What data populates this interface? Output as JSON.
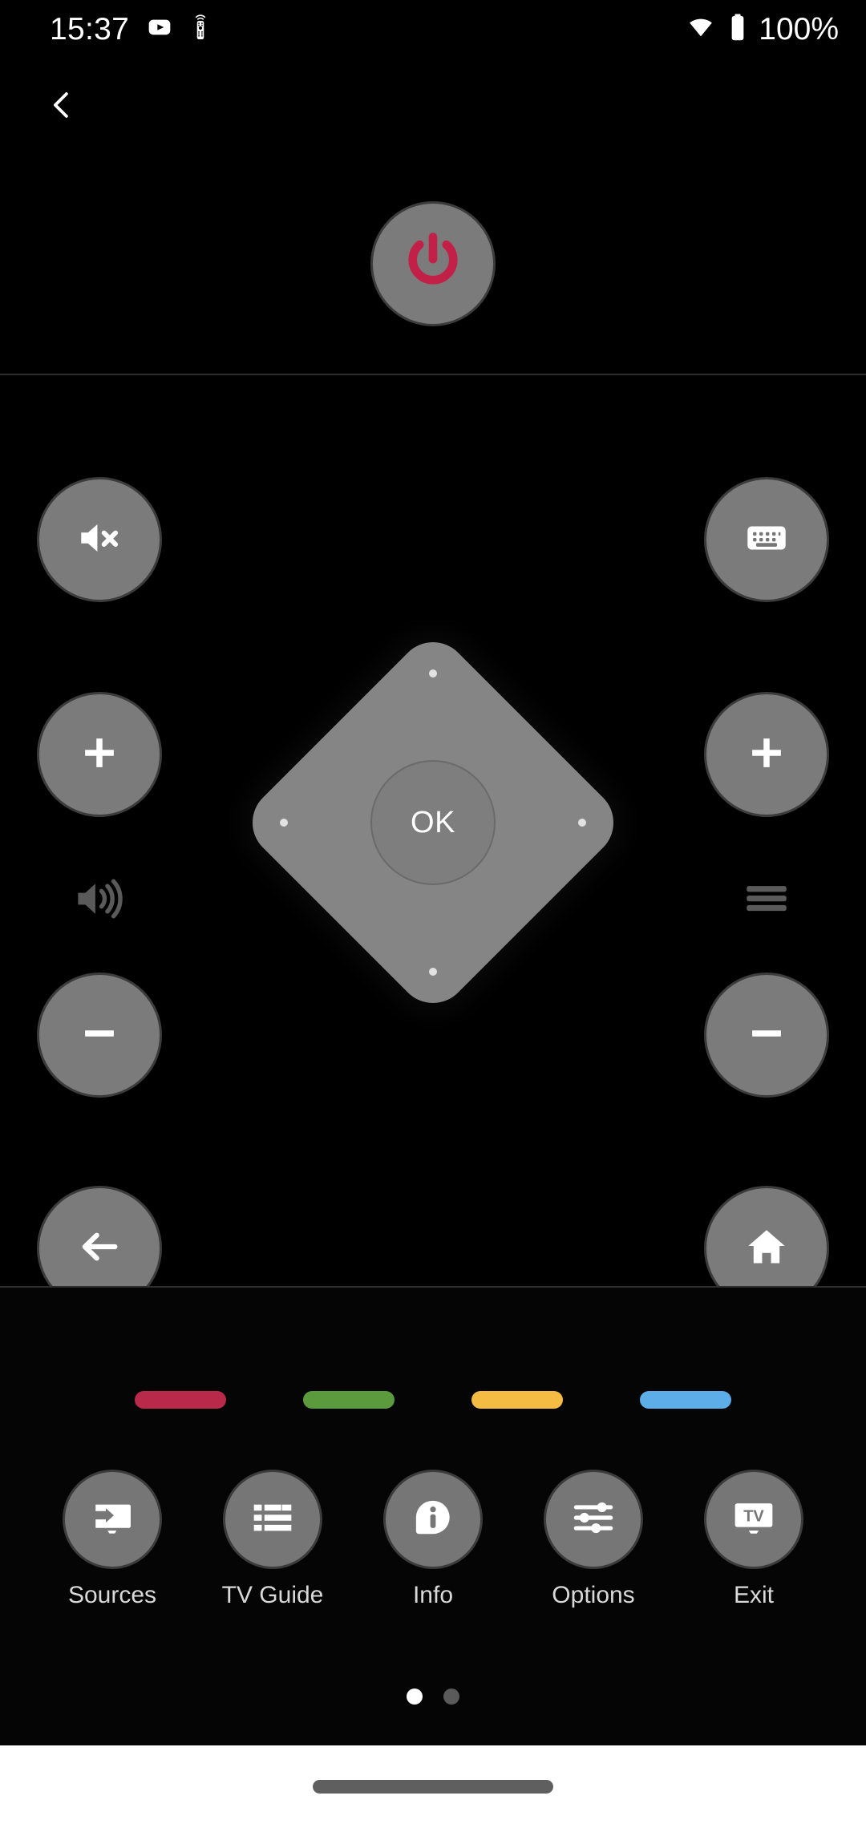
{
  "status_bar": {
    "time": "15:37",
    "battery_percent": "100%",
    "icons": [
      "youtube-icon",
      "remote-notification-icon",
      "wifi-icon",
      "battery-icon"
    ]
  },
  "top_bar": {
    "back_label": "Back",
    "back_icon": "chevron-left-icon"
  },
  "power": {
    "label": "Power",
    "icon": "power-icon",
    "icon_color": "#c32048"
  },
  "dpad": {
    "ok_label": "OK",
    "up_label": "Up",
    "down_label": "Down",
    "left_label": "Left",
    "right_label": "Right"
  },
  "left_column": {
    "mute_label": "Mute",
    "mute_icon": "volume-mute-icon",
    "volume_up_label": "Volume Up",
    "volume_up_icon": "plus-icon",
    "volume_indicator_icon": "volume-up-icon",
    "volume_down_label": "Volume Down",
    "volume_down_icon": "minus-icon",
    "back_label": "Back",
    "back_icon": "arrow-left-icon"
  },
  "right_column": {
    "keyboard_label": "Keyboard",
    "keyboard_icon": "keyboard-icon",
    "channel_up_label": "Channel Up",
    "channel_up_icon": "plus-icon",
    "channel_indicator_icon": "channel-list-icon",
    "channel_down_label": "Channel Down",
    "channel_down_icon": "minus-icon",
    "home_label": "Home",
    "home_icon": "home-icon"
  },
  "color_buttons": [
    {
      "name": "red",
      "color": "#b8294a"
    },
    {
      "name": "green",
      "color": "#5b9b3d"
    },
    {
      "name": "yellow",
      "color": "#f5bc43"
    },
    {
      "name": "blue",
      "color": "#5cade8"
    }
  ],
  "function_buttons": [
    {
      "label": "Sources",
      "icon": "source-input-icon"
    },
    {
      "label": "TV Guide",
      "icon": "guide-list-icon"
    },
    {
      "label": "Info",
      "icon": "info-icon"
    },
    {
      "label": "Options",
      "icon": "sliders-icon"
    },
    {
      "label": "Exit",
      "icon": "tv-icon"
    }
  ],
  "pagination": {
    "pages": 2,
    "active_index": 0
  },
  "nav_bar": {
    "handle_label": "Gesture Handle"
  },
  "theme": {
    "background": "#000000",
    "button_fill": "#7b7b7b",
    "button_border": "#3c3c3c",
    "icon_color": "#ffffff",
    "divider": "#2e2e2e",
    "accent_red": "#c32048"
  }
}
